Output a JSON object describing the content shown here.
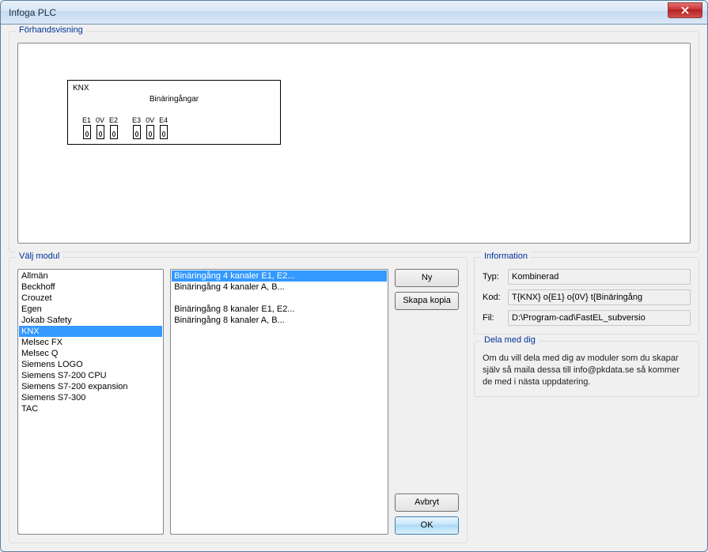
{
  "window_title": "Infoga PLC",
  "preview": {
    "group_label": "Förhandsvisning",
    "plc_label": "KNX",
    "plc_title": "Binäringångar",
    "terminals": [
      "E1",
      "0V",
      "E2",
      "E3",
      "0V",
      "E4"
    ]
  },
  "module": {
    "group_label": "Välj modul",
    "vendors": [
      "Allmän",
      "Beckhoff",
      "Crouzet",
      "Egen",
      "Jokab Safety",
      "KNX",
      "Melsec FX",
      "Melsec Q",
      "Siemens LOGO",
      "Siemens S7-200 CPU",
      "Siemens S7-200 expansion",
      "Siemens S7-300",
      "TAC"
    ],
    "selected_vendor_index": 5,
    "modules": [
      "Binäringång 4 kanaler E1, E2...",
      "Binäringång 4 kanaler A, B...",
      "",
      "Binäringång 8 kanaler E1, E2...",
      "Binäringång 8 kanaler A, B..."
    ],
    "selected_module_index": 0,
    "buttons": {
      "new": "Ny",
      "copy": "Skapa kopia",
      "cancel": "Avbryt",
      "ok": "OK"
    }
  },
  "info": {
    "group_label": "Information",
    "labels": {
      "type": "Typ:",
      "code": "Kod:",
      "file": "Fil:"
    },
    "type": "Kombinerad",
    "code": "T{KNX} o{E1} o{0V} t{Binäringång",
    "file": "D:\\Program-cad\\FastEL_subversio"
  },
  "share": {
    "group_label": "Dela med dig",
    "text": "Om du vill dela med dig av moduler som du skapar själv så maila dessa till info@pkdata.se så kommer de med i nästa uppdatering."
  }
}
